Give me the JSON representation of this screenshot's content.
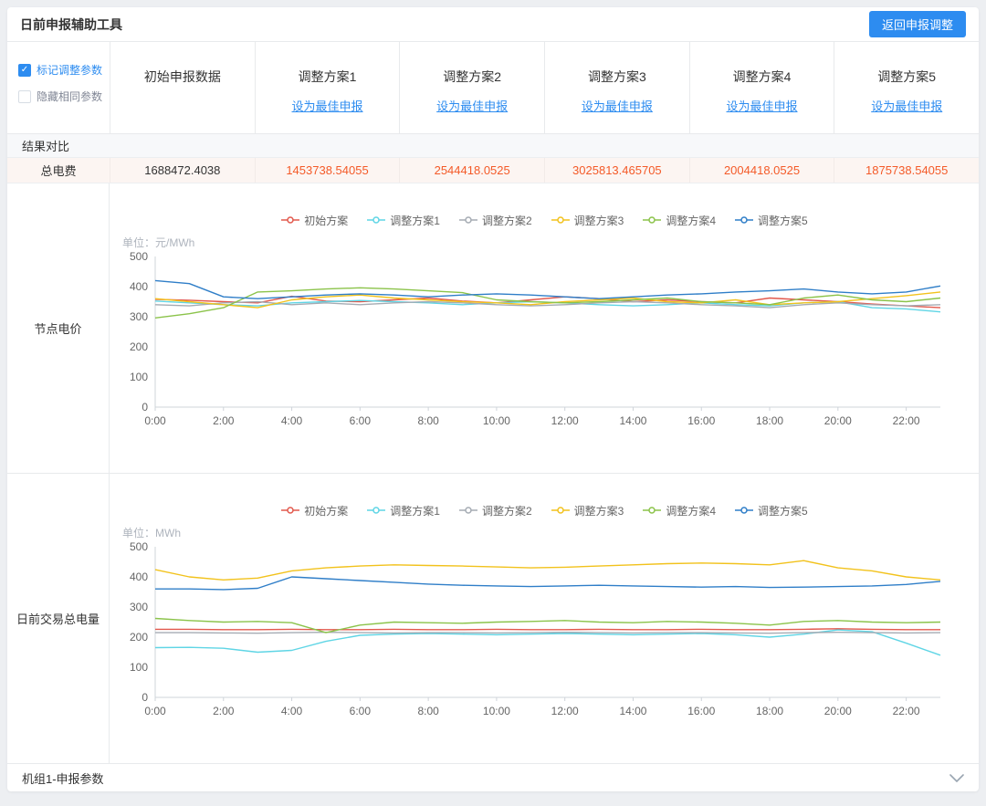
{
  "header": {
    "title": "日前申报辅助工具",
    "back_button": "返回申报调整"
  },
  "controls": {
    "mark_label": "标记调整参数",
    "hide_label": "隐藏相同参数",
    "mark_checked": true,
    "hide_checked": false
  },
  "columns": [
    {
      "label": "初始申报数据"
    },
    {
      "label": "调整方案1",
      "link": "设为最佳申报"
    },
    {
      "label": "调整方案2",
      "link": "设为最佳申报"
    },
    {
      "label": "调整方案3",
      "link": "设为最佳申报"
    },
    {
      "label": "调整方案4",
      "link": "设为最佳申报"
    },
    {
      "label": "调整方案5",
      "link": "设为最佳申报"
    }
  ],
  "results": {
    "section_title": "结果对比",
    "row_label": "总电费",
    "values": [
      "1688472.4038",
      "1453738.54055",
      "2544418.0525",
      "3025813.465705",
      "2004418.0525",
      "1875738.54055"
    ]
  },
  "footer": {
    "title": "机组1-申报参数",
    "chevron_icon": "chevron-down"
  },
  "colors": {
    "accent": "#2d8cf0",
    "warn_value": "#f45a28",
    "axis_line": "#cfd4da",
    "axis_text": "#666666"
  },
  "chart_data": [
    {
      "type": "line",
      "row_label": "节点电价",
      "unit_label": "单位：元/MWh",
      "ylim": [
        0,
        500
      ],
      "y_tick_step": 100,
      "x_tick_every": 2,
      "grid": false,
      "legend_position": "top",
      "x": [
        "0:00",
        "1:00",
        "2:00",
        "3:00",
        "4:00",
        "5:00",
        "6:00",
        "7:00",
        "8:00",
        "9:00",
        "10:00",
        "11:00",
        "12:00",
        "13:00",
        "14:00",
        "15:00",
        "16:00",
        "17:00",
        "18:00",
        "19:00",
        "20:00",
        "21:00",
        "22:00",
        "23:00"
      ],
      "series": [
        {
          "name": "初始方案",
          "color": "#e2584c",
          "values": [
            358,
            355,
            350,
            346,
            368,
            352,
            350,
            356,
            362,
            352,
            346,
            356,
            366,
            360,
            350,
            356,
            350,
            346,
            362,
            356,
            350,
            342,
            336,
            330
          ]
        },
        {
          "name": "调整方案1",
          "color": "#5fd5e5",
          "values": [
            352,
            346,
            340,
            336,
            346,
            350,
            354,
            350,
            346,
            340,
            346,
            350,
            346,
            340,
            336,
            340,
            346,
            340,
            336,
            346,
            350,
            330,
            326,
            316
          ]
        },
        {
          "name": "调整方案2",
          "color": "#a5abb3",
          "values": [
            340,
            336,
            346,
            350,
            340,
            346,
            340,
            346,
            350,
            346,
            340,
            336,
            340,
            346,
            350,
            346,
            340,
            336,
            330,
            340,
            346,
            340,
            336,
            340
          ]
        },
        {
          "name": "调整方案3",
          "color": "#f2c21c",
          "values": [
            360,
            350,
            340,
            330,
            356,
            366,
            372,
            362,
            356,
            350,
            346,
            340,
            350,
            356,
            362,
            350,
            346,
            356,
            340,
            346,
            350,
            360,
            370,
            382
          ]
        },
        {
          "name": "调整方案4",
          "color": "#8bc34a",
          "values": [
            296,
            310,
            330,
            382,
            386,
            392,
            396,
            392,
            386,
            380,
            356,
            350,
            346,
            350,
            356,
            362,
            350,
            346,
            340,
            362,
            372,
            356,
            350,
            362
          ]
        },
        {
          "name": "调整方案5",
          "color": "#2f7ec8",
          "values": [
            420,
            410,
            366,
            360,
            366,
            372,
            376,
            372,
            366,
            372,
            376,
            372,
            366,
            360,
            366,
            372,
            376,
            382,
            386,
            392,
            382,
            376,
            382,
            402
          ]
        }
      ]
    },
    {
      "type": "line",
      "row_label": "日前交易总电量",
      "unit_label": "单位：MWh",
      "ylim": [
        0,
        500
      ],
      "y_tick_step": 100,
      "x_tick_every": 2,
      "grid": false,
      "legend_position": "top",
      "x": [
        "0:00",
        "1:00",
        "2:00",
        "3:00",
        "4:00",
        "5:00",
        "6:00",
        "7:00",
        "8:00",
        "9:00",
        "10:00",
        "11:00",
        "12:00",
        "13:00",
        "14:00",
        "15:00",
        "16:00",
        "17:00",
        "18:00",
        "19:00",
        "20:00",
        "21:00",
        "22:00",
        "23:00"
      ],
      "series": [
        {
          "name": "初始方案",
          "color": "#e2584c",
          "values": [
            226,
            226,
            225,
            225,
            226,
            225,
            225,
            226,
            225,
            225,
            226,
            225,
            225,
            226,
            225,
            225,
            226,
            225,
            225,
            226,
            228,
            226,
            225,
            225
          ]
        },
        {
          "name": "调整方案1",
          "color": "#5fd5e5",
          "values": [
            165,
            166,
            163,
            150,
            156,
            186,
            206,
            210,
            212,
            210,
            208,
            210,
            212,
            210,
            208,
            210,
            212,
            208,
            200,
            210,
            224,
            218,
            180,
            140
          ]
        },
        {
          "name": "调整方案2",
          "color": "#a5abb3",
          "values": [
            215,
            215,
            214,
            213,
            215,
            216,
            215,
            214,
            215,
            215,
            214,
            215,
            216,
            215,
            214,
            215,
            215,
            214,
            213,
            215,
            216,
            215,
            214,
            215
          ]
        },
        {
          "name": "调整方案3",
          "color": "#f2c21c",
          "values": [
            424,
            400,
            390,
            396,
            420,
            430,
            436,
            440,
            438,
            436,
            433,
            430,
            432,
            436,
            440,
            444,
            446,
            444,
            440,
            454,
            430,
            420,
            400,
            390
          ]
        },
        {
          "name": "调整方案4",
          "color": "#8bc34a",
          "values": [
            262,
            255,
            250,
            252,
            248,
            215,
            240,
            250,
            248,
            246,
            250,
            252,
            255,
            250,
            248,
            252,
            250,
            246,
            240,
            252,
            255,
            250,
            248,
            250
          ]
        },
        {
          "name": "调整方案5",
          "color": "#2f7ec8",
          "values": [
            360,
            360,
            358,
            362,
            400,
            394,
            388,
            382,
            376,
            372,
            370,
            368,
            370,
            372,
            370,
            368,
            366,
            368,
            365,
            366,
            368,
            370,
            375,
            385
          ]
        }
      ]
    }
  ]
}
